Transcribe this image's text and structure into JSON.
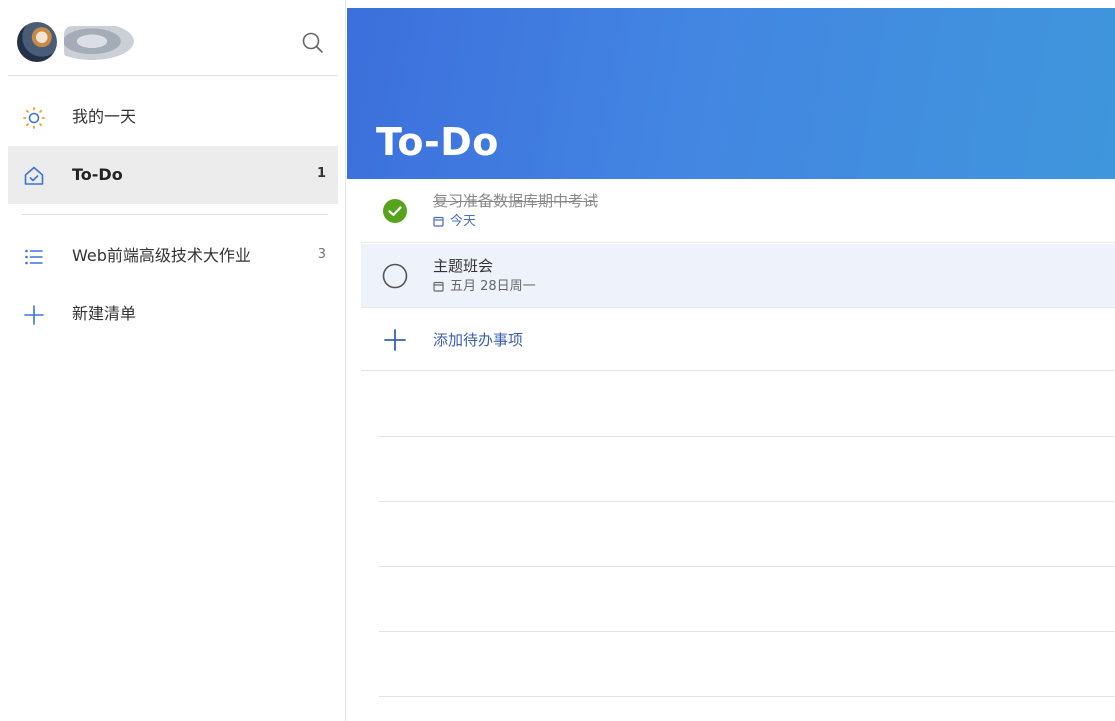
{
  "sidebar": {
    "items": [
      {
        "label": "我的一天",
        "count": "",
        "icon": "sun-icon"
      },
      {
        "label": "To-Do",
        "count": "1",
        "icon": "home-check-icon"
      },
      {
        "label": "Web前端高级技术大作业",
        "count": "3",
        "icon": "list-icon"
      },
      {
        "label": "新建清单",
        "count": "",
        "icon": "plus-icon"
      }
    ]
  },
  "main": {
    "title": "To-Do",
    "tasks": [
      {
        "title": "复习准备数据库期中考试",
        "due": "今天",
        "completed": true
      },
      {
        "title": "主题班会",
        "due": "五月 28日周一",
        "completed": false
      }
    ],
    "add_label": "添加待办事项"
  },
  "colors": {
    "accent": "#3c6fdc",
    "complete_green": "#57a31b",
    "link_blue": "#3b5fb0"
  }
}
